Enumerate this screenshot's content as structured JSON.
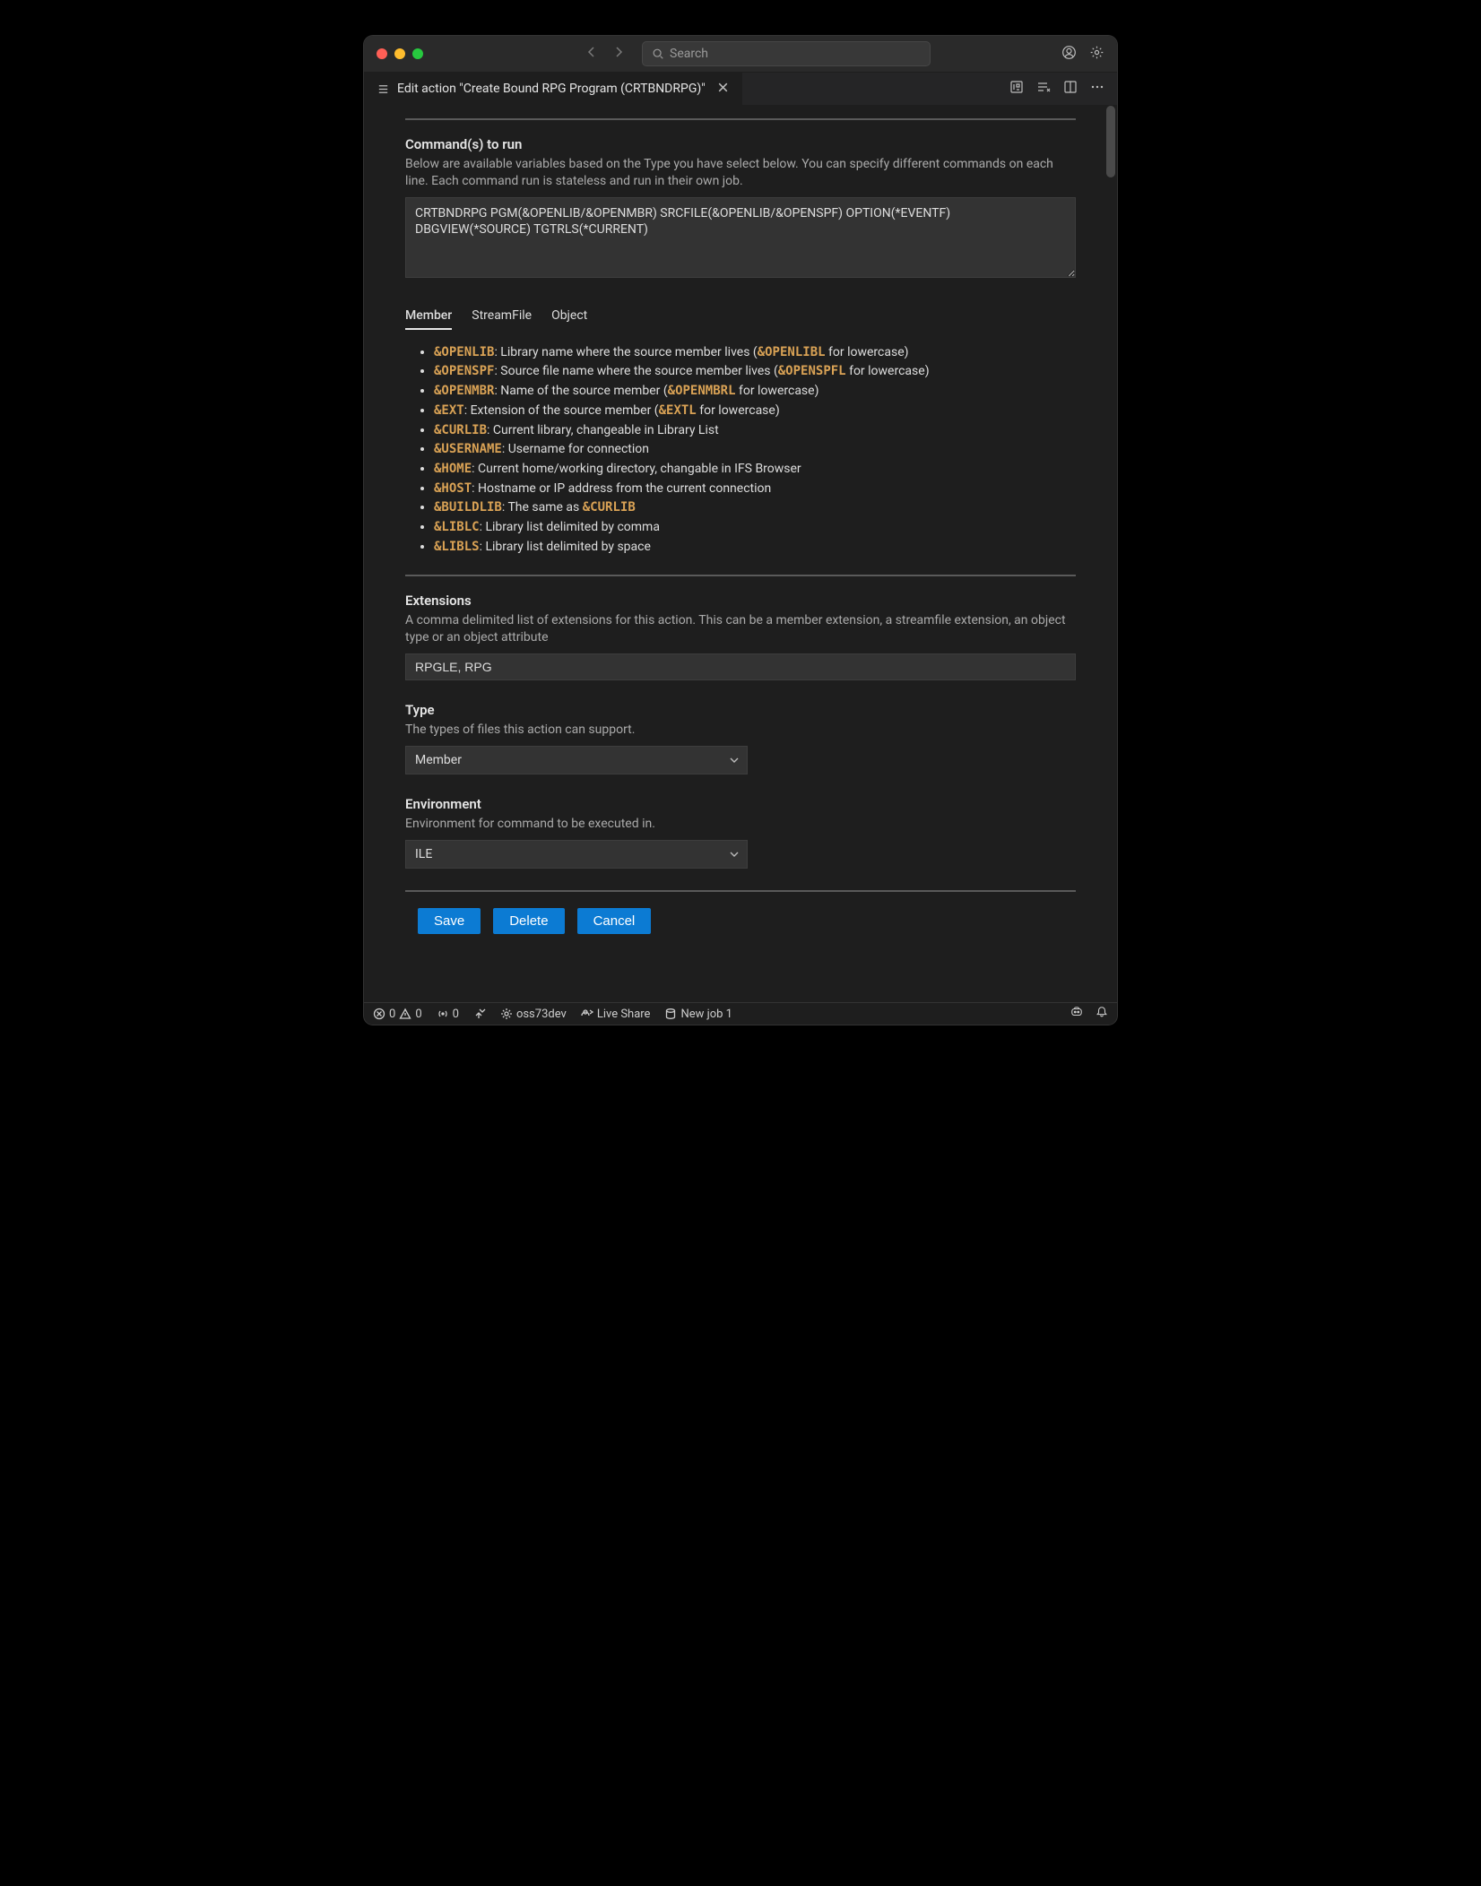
{
  "titlebar": {
    "search_placeholder": "Search"
  },
  "tab": {
    "title": "Edit action \"Create Bound RPG Program (CRTBNDRPG)\""
  },
  "commands": {
    "title": "Command(s) to run",
    "desc": "Below are available variables based on the Type you have select below. You can specify different commands on each line. Each command run is stateless and run in their own job.",
    "value": "CRTBNDRPG PGM(&OPENLIB/&OPENMBR) SRCFILE(&OPENLIB/&OPENSPF) OPTION(*EVENTF) DBGVIEW(*SOURCE) TGTRLS(*CURRENT)"
  },
  "varTabs": [
    "Member",
    "StreamFile",
    "Object"
  ],
  "vars": [
    {
      "tok": "&OPENLIB",
      "txt": ": Library name where the source member lives (",
      "tok2": "&OPENLIBL",
      "txt2": " for lowercase)"
    },
    {
      "tok": "&OPENSPF",
      "txt": ": Source file name where the source member lives (",
      "tok2": "&OPENSPFL",
      "txt2": " for lowercase)"
    },
    {
      "tok": "&OPENMBR",
      "txt": ": Name of the source member (",
      "tok2": "&OPENMBRL",
      "txt2": " for lowercase)"
    },
    {
      "tok": "&EXT",
      "txt": ": Extension of the source member (",
      "tok2": "&EXTL",
      "txt2": " for lowercase)"
    },
    {
      "tok": "&CURLIB",
      "txt": ": Current library, changeable in Library List"
    },
    {
      "tok": "&USERNAME",
      "txt": ": Username for connection"
    },
    {
      "tok": "&HOME",
      "txt": ": Current home/working directory, changable in IFS Browser"
    },
    {
      "tok": "&HOST",
      "txt": ": Hostname or IP address from the current connection"
    },
    {
      "tok": "&BUILDLIB",
      "txt": ": The same as ",
      "tok2": "&CURLIB"
    },
    {
      "tok": "&LIBLC",
      "txt": ": Library list delimited by comma"
    },
    {
      "tok": "&LIBLS",
      "txt": ": Library list delimited by space"
    }
  ],
  "extensions": {
    "title": "Extensions",
    "desc": "A comma delimited list of extensions for this action. This can be a member extension, a streamfile extension, an object type or an object attribute",
    "value": "RPGLE, RPG"
  },
  "type": {
    "title": "Type",
    "desc": "The types of files this action can support.",
    "value": "Member"
  },
  "env": {
    "title": "Environment",
    "desc": "Environment for command to be executed in.",
    "value": "ILE"
  },
  "buttons": {
    "save": "Save",
    "delete": "Delete",
    "cancel": "Cancel"
  },
  "status": {
    "errors": "0",
    "warnings": "0",
    "ports": "0",
    "host": "oss73dev",
    "liveshare": "Live Share",
    "job": "New job 1"
  }
}
